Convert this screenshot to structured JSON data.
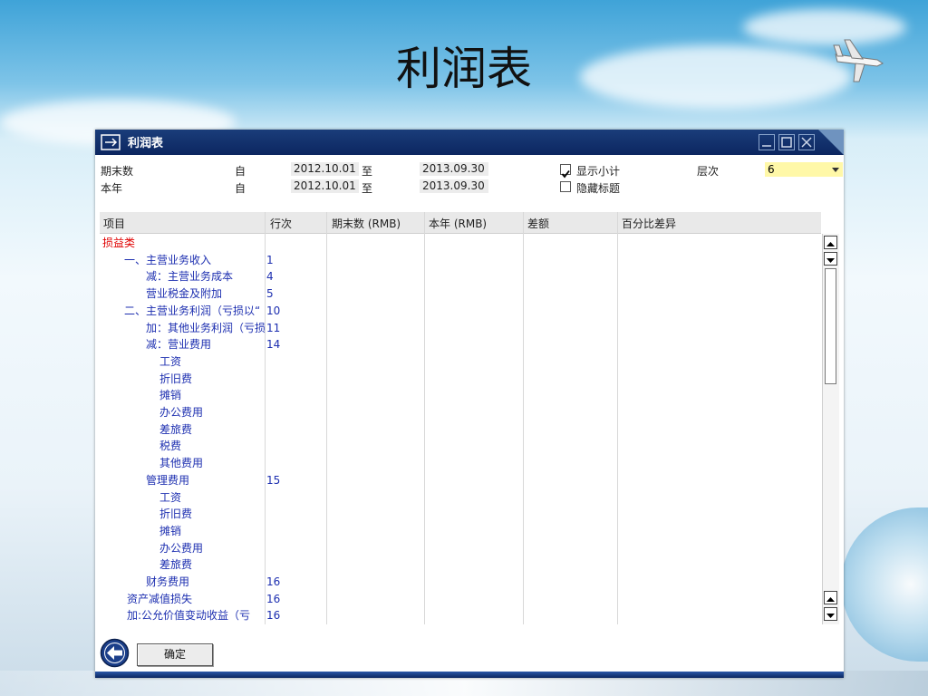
{
  "slide": {
    "title": "利润表"
  },
  "window": {
    "title": "利润表",
    "buttons": [
      "minimize",
      "maximize",
      "close"
    ]
  },
  "filters": {
    "row1": {
      "label": "期末数",
      "from_label": "自",
      "from": "2012.10.01",
      "to_label": "至",
      "to": "2013.09.30"
    },
    "row2": {
      "label": "本年",
      "from_label": "自",
      "from": "2012.10.01",
      "to_label": "至",
      "to": "2013.09.30"
    },
    "show_subtotal": {
      "label": "显示小计",
      "checked": true
    },
    "hide_title": {
      "label": "隐藏标题",
      "checked": false
    },
    "level": {
      "label": "层次",
      "value": "6"
    }
  },
  "table": {
    "columns": [
      "项目",
      "行次",
      "期末数 (RMB)",
      "本年 (RMB)",
      "差额",
      "百分比差异"
    ],
    "category": "损益类",
    "rows": [
      {
        "item": "一、主营业务收入",
        "line": "1",
        "indent": 1
      },
      {
        "item": "减：主营业务成本",
        "line": "4",
        "indent": 2
      },
      {
        "item": "营业税金及附加",
        "line": "5",
        "indent": 2
      },
      {
        "item": "二、主营业务利润（亏损以“",
        "line": "10",
        "indent": 1
      },
      {
        "item": "加：其他业务利润（亏损",
        "line": "11",
        "indent": 2
      },
      {
        "item": "减：营业费用",
        "line": "14",
        "indent": 2
      },
      {
        "item": "工资",
        "line": "",
        "indent": 3
      },
      {
        "item": "折旧费",
        "line": "",
        "indent": 3
      },
      {
        "item": "摊销",
        "line": "",
        "indent": 3
      },
      {
        "item": "办公费用",
        "line": "",
        "indent": 3
      },
      {
        "item": "差旅费",
        "line": "",
        "indent": 3
      },
      {
        "item": "税费",
        "line": "",
        "indent": 3
      },
      {
        "item": "其他费用",
        "line": "",
        "indent": 3
      },
      {
        "item": "管理费用",
        "line": "15",
        "indent": 2
      },
      {
        "item": "工资",
        "line": "",
        "indent": 3
      },
      {
        "item": "折旧费",
        "line": "",
        "indent": 3
      },
      {
        "item": "摊销",
        "line": "",
        "indent": 3
      },
      {
        "item": "办公费用",
        "line": "",
        "indent": 3
      },
      {
        "item": "差旅费",
        "line": "",
        "indent": 3
      },
      {
        "item": "财务费用",
        "line": "16",
        "indent": 2
      },
      {
        "item": "资产减值损失",
        "line": "16",
        "indent": 1.5
      },
      {
        "item": "加:公允价值变动收益（亏",
        "line": "16",
        "indent": 1.5
      }
    ]
  },
  "footer": {
    "ok_label": "确定"
  },
  "colors": {
    "titlebar": "#0c2660",
    "category": "#e00000",
    "item_text": "#1d2fb0",
    "level_bg": "#fff8a8"
  }
}
